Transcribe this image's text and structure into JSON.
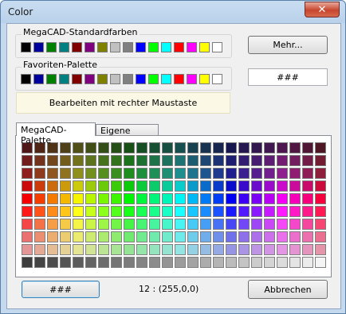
{
  "window": {
    "title": "Color"
  },
  "standard_colors": {
    "label": "MegaCAD-Standardfarben",
    "swatches": [
      "#000000",
      "#00009c",
      "#008000",
      "#008080",
      "#800000",
      "#800080",
      "#808000",
      "#c0c0c0",
      "#808080",
      "#0000ff",
      "#00ff00",
      "#00ffff",
      "#ff0000",
      "#ff00ff",
      "#ffff00",
      "#ffffff"
    ]
  },
  "favorites": {
    "label": "Favoriten-Palette",
    "swatches": [
      "#000000",
      "#00009c",
      "#008000",
      "#008080",
      "#800000",
      "#800080",
      "#808000",
      "#c0c0c0",
      "#808080",
      "#0000ff",
      "#00ff00",
      "#00ffff",
      "#ff0000",
      "#ff00ff",
      "#ffff00",
      "#ffffff"
    ]
  },
  "buttons": {
    "more_label": "Mehr...",
    "cancel_label": "Abbrechen",
    "color_label": "###"
  },
  "color_field": {
    "value": "###"
  },
  "hint": {
    "text": "Bearbeiten mit rechter Maustaste"
  },
  "tabs": [
    {
      "label": "MegaCAD-Palette",
      "active": true
    },
    {
      "label": "Eigene Palette",
      "active": false
    }
  ],
  "status": {
    "text": "12 : (255,0,0)"
  },
  "palette": {
    "columns": 24,
    "rows": 10
  }
}
